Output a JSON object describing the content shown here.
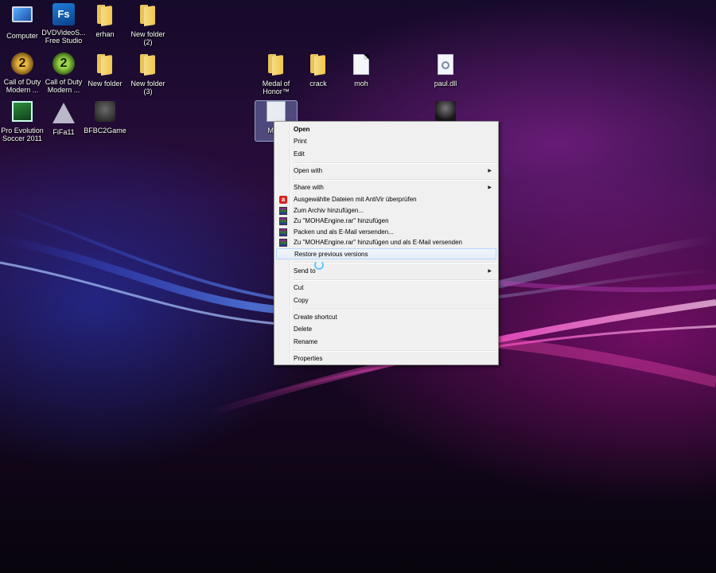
{
  "desktop": {
    "icons": [
      {
        "label": "Computer",
        "icon": "computer-icon"
      },
      {
        "label": "DVDVideoS...\nFree Studio",
        "icon": "dvdvideosoft-icon"
      },
      {
        "label": "erhan",
        "icon": "folder-icon"
      },
      {
        "label": "New folder\n(2)",
        "icon": "folder-icon"
      },
      {
        "label": "Call of Duty\nModern ...",
        "icon": "call-of-duty-icon"
      },
      {
        "label": "Call of Duty\nModern ...",
        "icon": "call-of-duty-icon"
      },
      {
        "label": "New folder",
        "icon": "folder-icon"
      },
      {
        "label": "New folder\n(3)",
        "icon": "folder-icon"
      },
      {
        "label": "Medal of\nHonor™",
        "icon": "folder-icon"
      },
      {
        "label": "crack",
        "icon": "folder-icon"
      },
      {
        "label": "moh",
        "icon": "file-icon"
      },
      {
        "label": "paul.dll",
        "icon": "dll-file-icon"
      },
      {
        "label": "Pro Evolution\nSoccer 2011",
        "icon": "pes-icon"
      },
      {
        "label": "FiFa11",
        "icon": "fifa-icon"
      },
      {
        "label": "BFBC2Game",
        "icon": "bfbc2-icon"
      },
      {
        "label": "MOH",
        "icon": "exe-file-icon"
      },
      {
        "label": "",
        "icon": "soldier-icon"
      }
    ]
  },
  "context_menu": {
    "open": "Open",
    "print": "Print",
    "edit": "Edit",
    "open_with": "Open with",
    "share_with": "Share with",
    "antivir": "Ausgewählte Dateien mit AntiVir überprüfen",
    "add_archive": "Zum Archiv hinzufügen...",
    "add_rar": "Zu \"MOHAEngine.rar\" hinzufügen",
    "pack_email": "Packen und als E-Mail versenden...",
    "add_rar_email": "Zu \"MOHAEngine.rar\" hinzufügen und als E-Mail versenden",
    "restore": "Restore previous versions",
    "send_to": "Send to",
    "cut": "Cut",
    "copy": "Copy",
    "create_shortcut": "Create shortcut",
    "delete": "Delete",
    "rename": "Rename",
    "properties": "Properties",
    "submenu_arrow": "▶"
  },
  "colors": {
    "menu_bg": "#f0f0f0",
    "hover_border": "#b8d6fb",
    "selection": "#a0beff"
  }
}
